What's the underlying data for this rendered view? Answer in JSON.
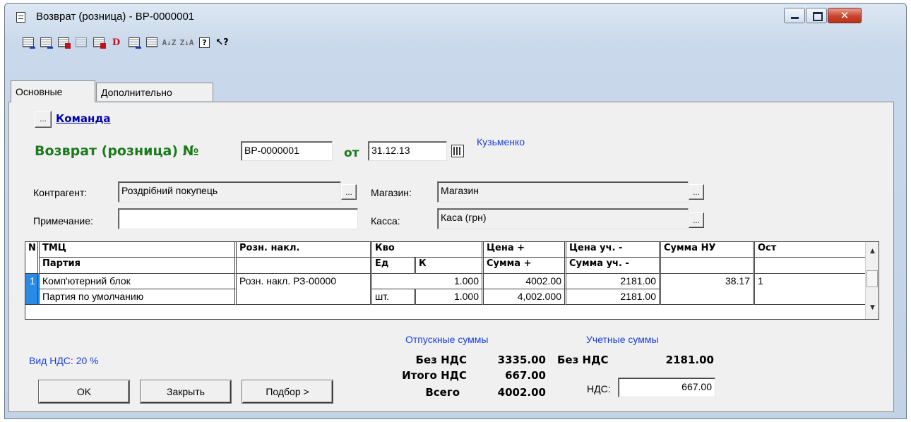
{
  "window": {
    "title": "Возврат (розница) - ВР-0000001",
    "close_glyph": "✕"
  },
  "toolbar": {
    "icons": [
      "add-row-icon",
      "copy-row-icon",
      "delete-row-icon",
      "edit-row-icon",
      "doc-x-icon",
      "dk-icon",
      "move-icon",
      "insert-icon",
      "sort-asc-icon",
      "sort-desc-icon",
      "help-icon",
      "whats-this-icon"
    ],
    "help_glyph": "?",
    "whats_this_glyph": "↖?",
    "sort_asc_glyph": "A↓Z",
    "sort_desc_glyph": "Z↓A"
  },
  "tabs": [
    {
      "label": "Основные"
    },
    {
      "label": "Дополнительно"
    }
  ],
  "form": {
    "command_button": "...",
    "command_link": "Команда",
    "doc_title": "Возврат (розница) №",
    "doc_number": "ВР-0000001",
    "from_label": "от",
    "doc_date": "31.12.13",
    "author": "Кузьменко",
    "contragent_label": "Контрагент:",
    "contragent_value": "Роздрібний покупець",
    "store_label": "Магазин:",
    "store_value": "Магазин",
    "note_label": "Примечание:",
    "note_value": "",
    "cash_label": "Касса:",
    "cash_value": "Каса (грн)",
    "ellipsis": "..."
  },
  "grid": {
    "headers_top": [
      "N",
      "ТМЦ",
      "Розн. накл.",
      "Кво",
      "Цена +",
      "Цена уч. -",
      "Сумма НУ",
      "Ост"
    ],
    "headers_bottom": [
      "Партия",
      "Ед",
      "К",
      "Сумма +",
      "Сумма уч. -"
    ],
    "row": {
      "n": "1",
      "item": "Комп'ютерний блок",
      "invoice": "Розн. накл. РЗ-00000",
      "qty": "1.000",
      "price": "4002.00",
      "price_acc": "2181.00",
      "sum_nu": "38.17",
      "rest": "1",
      "batch": "Партия по умолчанию",
      "unit": "шт.",
      "k": "1.000",
      "sum": "4,002.000",
      "sum_acc": "2181.00"
    }
  },
  "totals": {
    "sale_caption": "Отпускные суммы",
    "acc_caption": "Учетные суммы",
    "vat_kind": "Вид НДС: 20 %",
    "no_vat_label": "Без НДС",
    "no_vat_value": "3335.00",
    "vat_total_label": "Итого НДС",
    "vat_total_value": "667.00",
    "total_label": "Всего",
    "total_value": "4002.00",
    "acc_no_vat_label": "Без НДС",
    "acc_no_vat_value": "2181.00",
    "acc_vat_label": "НДС:",
    "acc_vat_value": "667.00"
  },
  "buttons": {
    "ok": "OK",
    "close": "Закрыть",
    "select": "Подбор >"
  },
  "colors": {
    "title_green": "#1b7a1b",
    "link_blue": "#0000aa",
    "caption_blue": "#1a3ee0"
  }
}
